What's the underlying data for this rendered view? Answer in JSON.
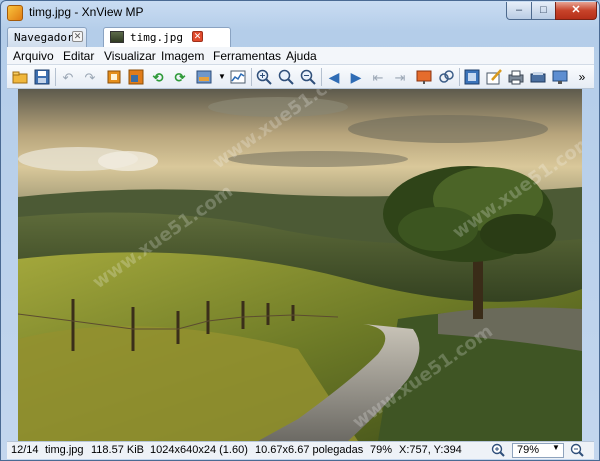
{
  "window": {
    "title": "timg.jpg - XnView MP",
    "minimize": "–",
    "maximize": "□",
    "close": "✕"
  },
  "tabs": [
    {
      "label": "Navegador",
      "close": "✕"
    },
    {
      "label": "timg.jpg",
      "close": "✕"
    }
  ],
  "menu": [
    "Arquivo",
    "Editar",
    "Visualizar",
    "Imagem",
    "Ferramentas",
    "Ajuda"
  ],
  "toolbar": {
    "icons": [
      "browse-folder-icon",
      "save-icon",
      "undo-icon",
      "redo-icon",
      "crop-icon",
      "resize-icon",
      "rotate-left-icon",
      "rotate-right-icon",
      "adjust-icon",
      "histogram-icon",
      "zoom-in-icon",
      "zoom-fit-icon",
      "zoom-out-icon",
      "previous-icon",
      "next-icon",
      "first-icon",
      "last-icon",
      "slideshow-icon",
      "compare-icon",
      "fullscreen-icon",
      "edit-icon",
      "print-icon",
      "scanner-icon",
      "wallpaper-icon"
    ],
    "more": "»"
  },
  "viewer": {
    "image_name": "timg.jpg",
    "watermark": "www.xue51.com"
  },
  "status": {
    "position": "12/14",
    "filename": "timg.jpg",
    "filesize": "118.57 KiB",
    "dimensions": "1024x640x24 (1.60)",
    "print_size": "10.67x6.67 polegadas",
    "zoom_percent": "79%",
    "coords": "X:757, Y:394",
    "zoom_value": "79%"
  },
  "colors": {
    "accent": "#3a6ea5",
    "close_red": "#c7432a"
  }
}
